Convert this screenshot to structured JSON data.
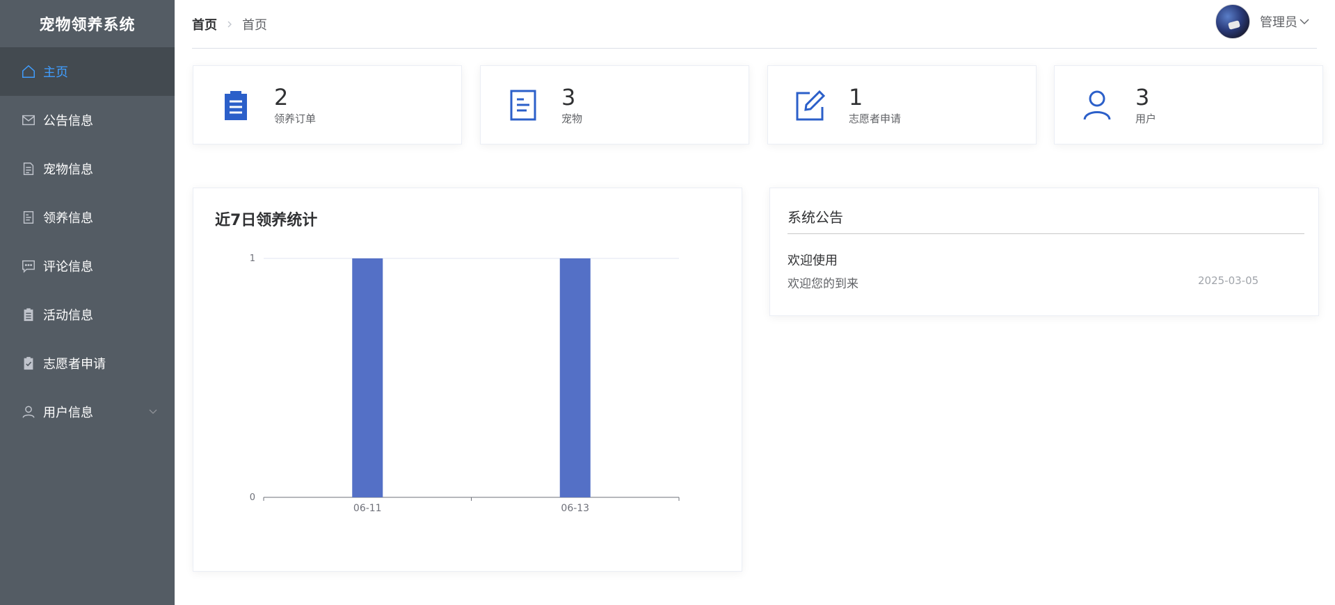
{
  "app": {
    "title": "宠物领养系统"
  },
  "sidebar": {
    "items": [
      {
        "label": "主页",
        "icon": "home-icon",
        "active": true
      },
      {
        "label": "公告信息",
        "icon": "mail-icon"
      },
      {
        "label": "宠物信息",
        "icon": "document-icon"
      },
      {
        "label": "领养信息",
        "icon": "tickets-icon"
      },
      {
        "label": "评论信息",
        "icon": "chat-dot-icon"
      },
      {
        "label": "活动信息",
        "icon": "clipboard-icon"
      },
      {
        "label": "志愿者申请",
        "icon": "checked-clipboard-icon"
      },
      {
        "label": "用户信息",
        "icon": "user-icon",
        "has_submenu": true
      }
    ]
  },
  "header": {
    "breadcrumb": {
      "root": "首页",
      "current": "首页"
    },
    "user": {
      "name": "管理员"
    }
  },
  "stats": [
    {
      "value": "2",
      "label": "领养订单",
      "icon": "clipboard-icon"
    },
    {
      "value": "3",
      "label": "宠物",
      "icon": "document-icon"
    },
    {
      "value": "1",
      "label": "志愿者申请",
      "icon": "edit-icon"
    },
    {
      "value": "3",
      "label": "用户",
      "icon": "user-icon"
    }
  ],
  "colors": {
    "accent": "#409eff",
    "icon_blue": "#2b5fc9",
    "bar": "#5470c6",
    "sidebar_bg": "#545c64"
  },
  "chart_data": {
    "type": "bar",
    "title": "近7日领养统计",
    "categories": [
      "06-11",
      "06-13"
    ],
    "values": [
      1,
      1
    ],
    "ylim": [
      0,
      1
    ],
    "yticks": [
      0,
      1
    ],
    "xlabel": "",
    "ylabel": "",
    "grid": true
  },
  "notice": {
    "title": "系统公告",
    "items": [
      {
        "title": "欢迎使用",
        "content": "欢迎您的到来",
        "date": "2025-03-05"
      }
    ]
  }
}
